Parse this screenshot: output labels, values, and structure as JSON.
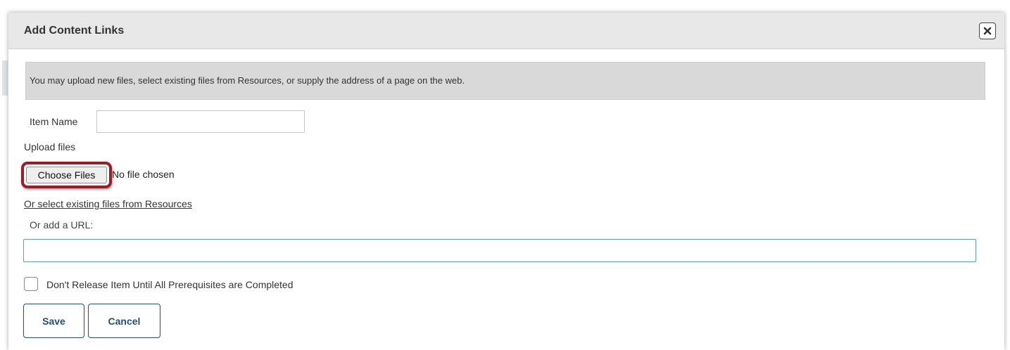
{
  "dialog": {
    "title": "Add Content Links",
    "close_icon": "close-icon",
    "info": "You may upload new files, select existing files from Resources, or supply the address of a page on the web."
  },
  "form": {
    "item_name_label": "Item Name",
    "item_name_value": "",
    "upload_label": "Upload files",
    "choose_files_label": "Choose Files",
    "no_file_text": "No file chosen",
    "resources_link": "Or select existing files from Resources",
    "url_label": "Or add a URL:",
    "url_value": "",
    "prereq_label": "Don't Release Item Until All Prerequisites are Completed",
    "prereq_checked": false
  },
  "buttons": {
    "save": "Save",
    "cancel": "Cancel"
  },
  "colors": {
    "highlight": "#9e1c26",
    "button_text": "#1f4f79",
    "url_border": "#5b9bd5"
  }
}
